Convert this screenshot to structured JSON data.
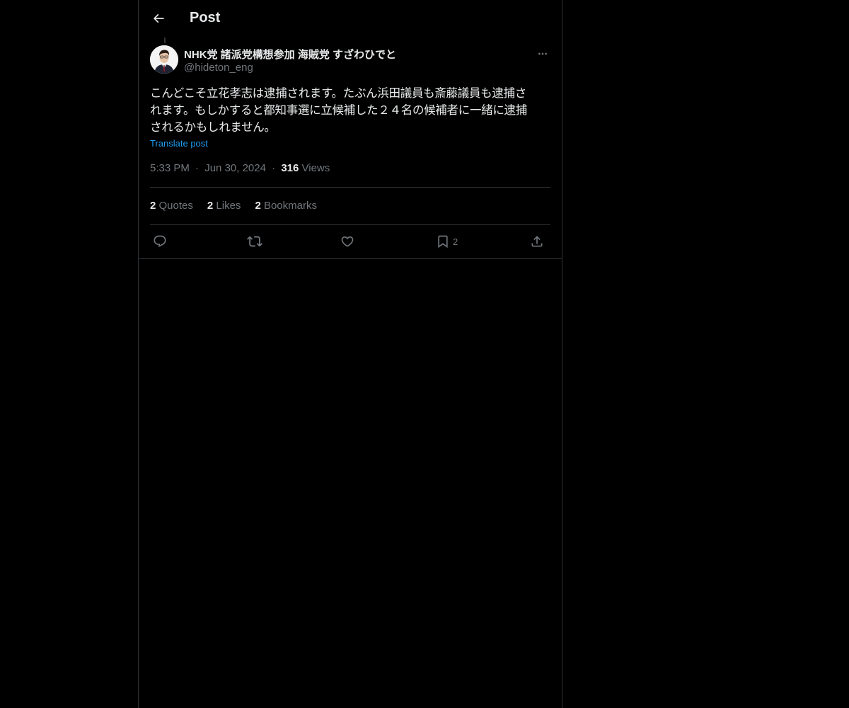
{
  "header": {
    "back_icon": "arrow-left-icon",
    "title": "Post"
  },
  "post": {
    "author": {
      "display_name": "NHK党 諸派党構想参加 海賊党 すざわひでと",
      "handle": "@hideton_eng",
      "avatar_icon": "user-photo"
    },
    "more_icon": "ellipsis-icon",
    "text_lines": [
      "こんどこそ立花孝志は逮捕されます。たぶん浜田議員も斎藤議員も逮捕さ",
      "れます。もしかすると都知事選に立候補した２４名の候補者に一緒に逮捕",
      "されるかもしれません。"
    ],
    "translate_label": "Translate post",
    "time": "5:33 PM",
    "separator": "·",
    "date": "Jun 30, 2024",
    "views_count": "316",
    "views_label": "Views"
  },
  "stats": {
    "quotes_count": "2",
    "quotes_label": "Quotes",
    "likes_count": "2",
    "likes_label": "Likes",
    "bookmarks_count": "2",
    "bookmarks_label": "Bookmarks"
  },
  "actions": {
    "reply_icon": "reply-icon",
    "repost_icon": "repost-icon",
    "like_icon": "heart-icon",
    "bookmark_icon": "bookmark-icon",
    "bookmark_count": "2",
    "share_icon": "share-icon"
  },
  "colors": {
    "background": "#000000",
    "text": "#e7e9ea",
    "muted": "#71767b",
    "accent": "#1d9bf0",
    "border": "#2f3336"
  }
}
